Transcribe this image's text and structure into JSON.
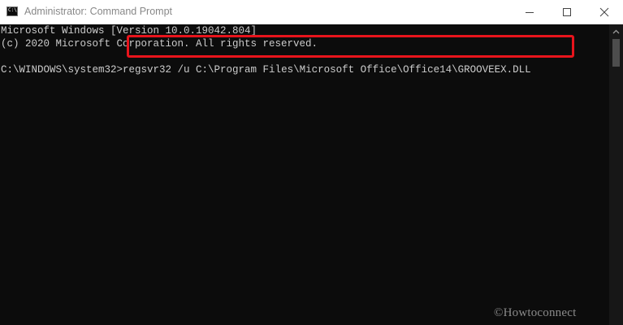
{
  "window": {
    "title": "Administrator: Command Prompt",
    "icon": "cmd-icon"
  },
  "console": {
    "line1": "Microsoft Windows [Version 10.0.19042.804]",
    "line2": "(c) 2020 Microsoft Corporation. All rights reserved.",
    "prompt": "C:\\WINDOWS\\system32>",
    "command": "regsvr32 /u C:\\Program Files\\Microsoft Office\\Office14\\GROOVEEX.DLL"
  },
  "watermark": {
    "text": "©Howtoconnect"
  },
  "colors": {
    "console_bg": "#0c0c0c",
    "console_text": "#cccccc",
    "highlight_border": "#e8141c",
    "titlebar_bg": "#ffffff",
    "title_text": "#888888"
  }
}
